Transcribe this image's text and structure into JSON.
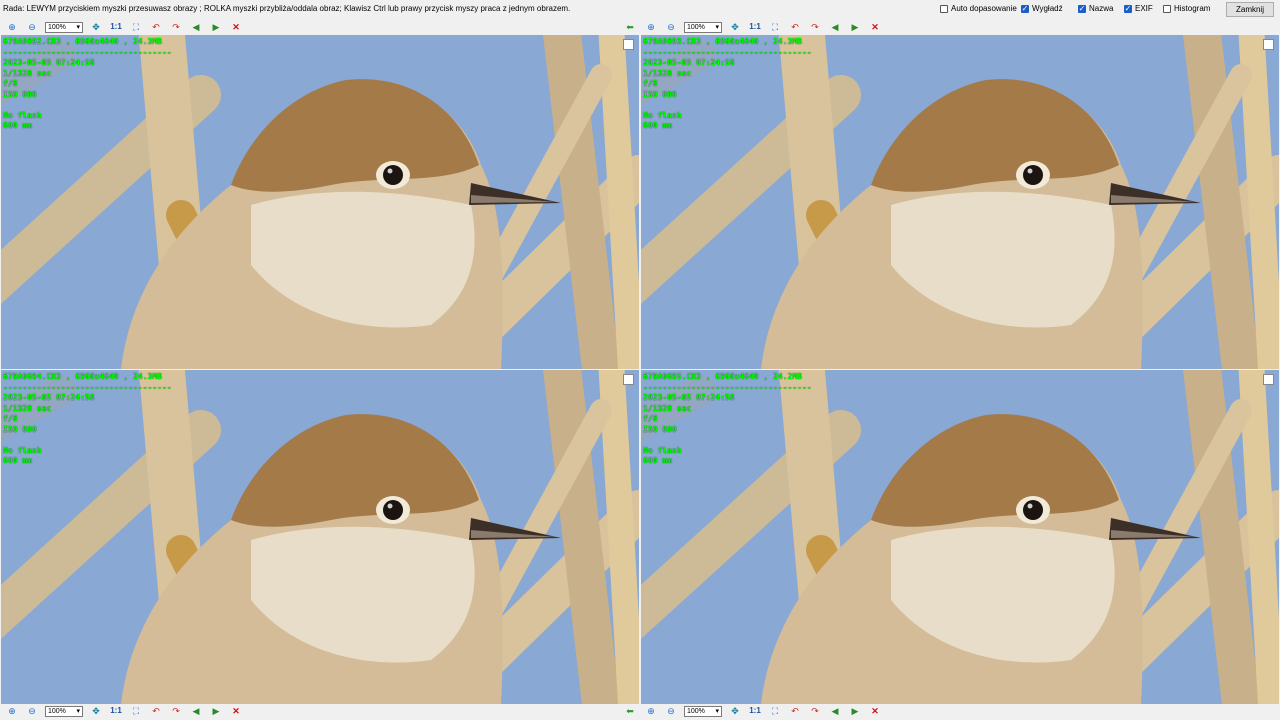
{
  "hint": "Rada: LEWYM przyciskiem myszki przesuwasz obrazy ; ROLKA myszki przybliża/oddala obraz; Klawisz Ctrl lub prawy przycisk myszy praca z jednym obrazem.",
  "options": [
    {
      "label": "Auto dopasowanie",
      "checked": false
    },
    {
      "label": "Wygładź",
      "checked": true
    },
    {
      "label": "Nazwa",
      "checked": true
    },
    {
      "label": "EXIF",
      "checked": true
    },
    {
      "label": "Histogram",
      "checked": false
    }
  ],
  "close_label": "Zamknij",
  "zoom": "100%",
  "one_to_one": "1:1",
  "panels": [
    {
      "name": "679A0692.CR3 , 6960x4640 , 24.3MB",
      "separator": "-----------------------------------",
      "date": "2023-05-05 07:24:58",
      "shutter": "1/1328 sec",
      "aperture": "f/8",
      "iso": "ISO 800",
      "flash": "No flash",
      "focal": "600 mm"
    },
    {
      "name": "679A0693.CR3 , 6960x4640 , 24.3MB",
      "separator": "-----------------------------------",
      "date": "2023-05-05 07:24:58",
      "shutter": "1/1328 sec",
      "aperture": "f/8",
      "iso": "ISO 800",
      "flash": "No flash",
      "focal": "600 mm"
    },
    {
      "name": "679A0694.CR3 , 6960x4640 , 24.3MB",
      "separator": "-----------------------------------",
      "date": "2023-05-05 07:24:58",
      "shutter": "1/1328 sec",
      "aperture": "f/8",
      "iso": "ISO 800",
      "flash": "No flash",
      "focal": "600 mm"
    },
    {
      "name": "679A0695.CR3 , 6960x4640 , 24.2MB",
      "separator": "-----------------------------------",
      "date": "2023-05-05 07:24:58",
      "shutter": "1/1328 sec",
      "aperture": "f/8",
      "iso": "ISO 800",
      "flash": "No flash",
      "focal": "600 mm"
    }
  ],
  "colors": {
    "exif_text": "#00ff00",
    "sky": "#8fb0d8",
    "reed": "#d8c39c",
    "plumage": "#a47a48",
    "throat": "#e8ddc8"
  }
}
